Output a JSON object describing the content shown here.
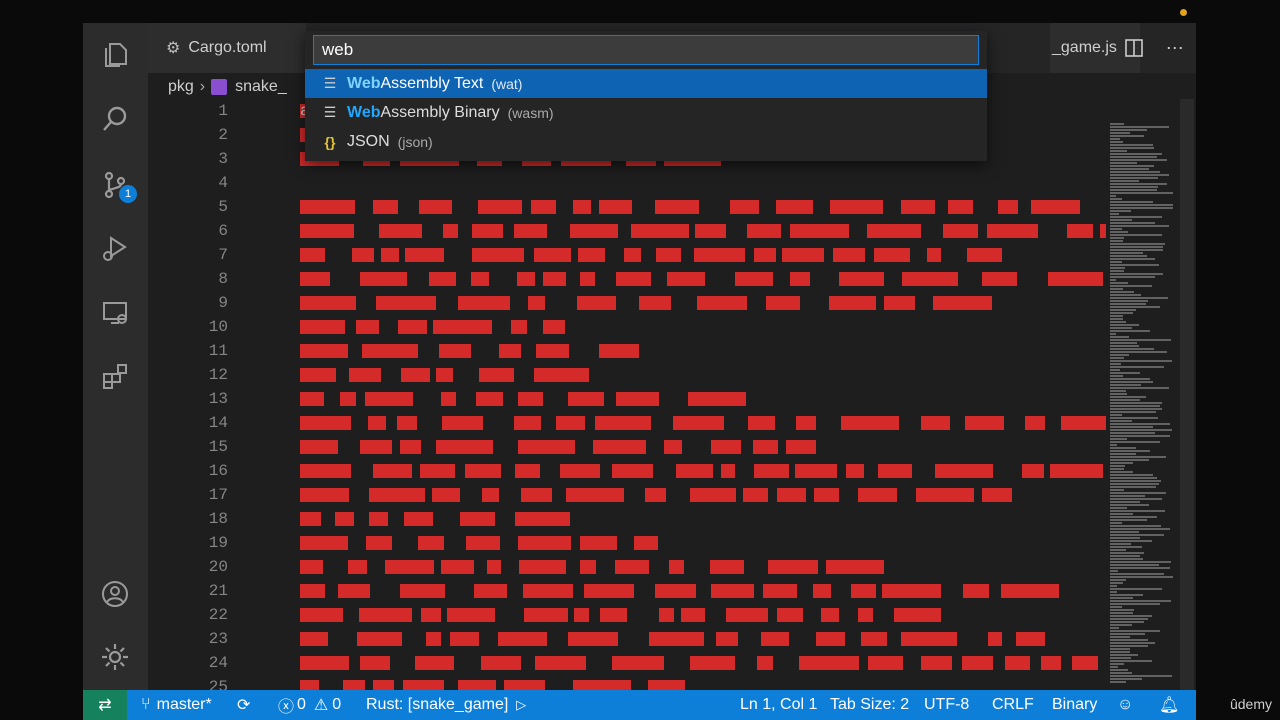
{
  "tabs": {
    "cargo_label": "Cargo.toml",
    "snake_label": "_game.js"
  },
  "breadcrumb": {
    "folder": "pkg",
    "file": "snake_"
  },
  "quick_open": {
    "value": "web",
    "items": [
      {
        "icon": "lines-icon",
        "highlight": "Web",
        "rest": "Assembly Text",
        "desc": "(wat)",
        "selected": true
      },
      {
        "icon": "lines-icon",
        "highlight": "Web",
        "rest": "Assembly Binary",
        "desc": "(wasm)",
        "selected": false
      },
      {
        "icon": "braces-icon",
        "highlight": "",
        "rest": "JSON",
        "desc": "(json)",
        "selected": false
      }
    ]
  },
  "editor": {
    "line_numbers": [
      "1",
      "2",
      "3",
      "4",
      "5",
      "6",
      "7",
      "8",
      "9",
      "10",
      "11",
      "12",
      "13",
      "14",
      "15",
      "16",
      "17",
      "18",
      "19",
      "20",
      "21",
      "22",
      "23",
      "24",
      "25"
    ],
    "line1_text": "asm",
    "line12_text": "vg\"  kvA  q   tkA>j!       k!        A tA      j(     \"   E"
  },
  "activity_bar": {
    "source_control_badge": "1"
  },
  "status_bar": {
    "branch": "master*",
    "errors": "0",
    "warnings": "0",
    "rust_status": "Rust: [snake_game]",
    "position": "Ln 1, Col 1",
    "tab_size": "Tab Size: 2",
    "encoding": "UTF-8",
    "eol": "CRLF",
    "language": "Binary"
  },
  "watermark": "ûdemy",
  "colors": {
    "accent": "#0e7fd8",
    "error_highlight": "#d42a2a",
    "remote": "#16825d"
  }
}
